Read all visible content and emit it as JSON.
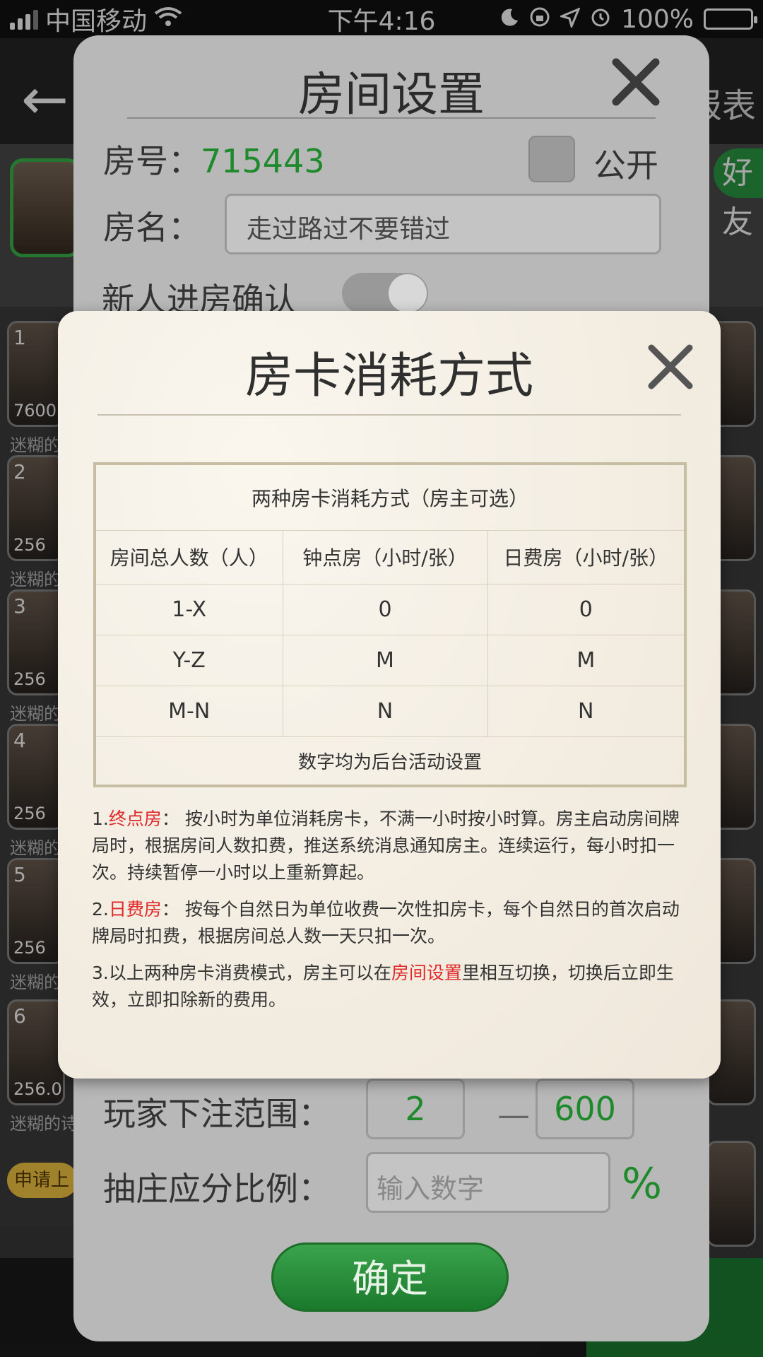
{
  "status_bar": {
    "carrier": "中国移动",
    "time": "下午4:16",
    "battery": "100%",
    "battery_color": "#2ecc40"
  },
  "background_app": {
    "report_link": "报表",
    "friend_button": "好友",
    "players": [
      {
        "rank": "1",
        "score": "7600",
        "name": "迷糊的"
      },
      {
        "rank": "2",
        "score": "256",
        "name": "迷糊的"
      },
      {
        "rank": "3",
        "score": "256",
        "name": "迷糊的"
      },
      {
        "rank": "4",
        "score": "256",
        "name": "迷糊的"
      },
      {
        "rank": "5",
        "score": "256",
        "name": "迷糊的"
      },
      {
        "rank": "6",
        "score": "256.0",
        "name": "迷糊的诗"
      }
    ],
    "apply_button": "申请上"
  },
  "room_settings": {
    "title": "房间设置",
    "room_no_label": "房号：",
    "room_no": "715443",
    "public_label": "公开",
    "room_name_label": "房名：",
    "room_name_value": "走过路过不要错过",
    "newcomer_confirm_label": "新人进房确认",
    "bet_range_label": "玩家下注范围：",
    "bet_min": "2",
    "bet_max": "600",
    "dealer_ratio_label": "抽庄应分比例：",
    "dealer_ratio_placeholder": "输入数字",
    "percent": "%",
    "confirm_button": "确定"
  },
  "card_modal": {
    "title": "房卡消耗方式",
    "table_caption": "两种房卡消耗方式（房主可选）",
    "headers": [
      "房间总人数（人）",
      "钟点房（小时/张）",
      "日费房（小时/张）"
    ],
    "rows": [
      [
        "1-X",
        "0",
        "0"
      ],
      [
        "Y-Z",
        "M",
        "M"
      ],
      [
        "M-N",
        "N",
        "N"
      ]
    ],
    "table_footer": "数字均为后台活动设置",
    "note1_prefix": "1.",
    "note1_term": "终点房",
    "note1_text": "： 按小时为单位消耗房卡，不满一小时按小时算。房主启动房间牌局时，根据房间人数扣费，推送系统消息通知房主。连续运行，每小时扣一次。持续暂停一小时以上重新算起。",
    "note2_prefix": "2.",
    "note2_term": "日费房",
    "note2_text": "： 按每个自然日为单位收费一次性扣房卡，每个自然日的首次启动牌局时扣费，根据房间总人数一天只扣一次。",
    "note3_prefix": "3.以上两种房卡消费模式，房主可以在",
    "note3_link": "房间设置",
    "note3_text": "里相互切换，切换后立即生效，立即扣除新的费用。",
    "accent_red": "#e02a2a"
  }
}
